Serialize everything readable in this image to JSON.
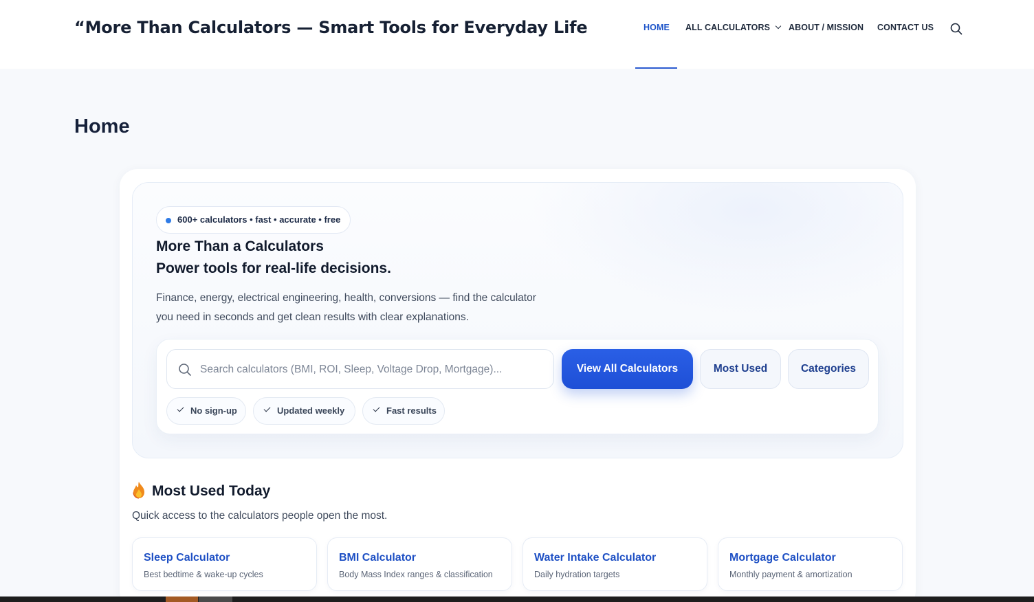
{
  "site": {
    "title": "“More Than Calculators — Smart Tools for Everyday Life"
  },
  "nav": {
    "items": [
      {
        "label": "HOME",
        "active": true
      },
      {
        "label": "ALL CALCULATORS",
        "has_dropdown": true
      },
      {
        "label": "ABOUT / MISSION"
      },
      {
        "label": "CONTACT US"
      }
    ],
    "search_icon": "search-icon"
  },
  "page": {
    "title": "Home"
  },
  "hero": {
    "badge": "600+ calculators • fast • accurate • free",
    "heading_line1": "More Than a Calculators",
    "heading_line2": "Power tools for real-life decisions.",
    "description": "Finance, energy, electrical engineering, health, conversions — find the calculator you need in seconds and get clean results with clear explanations.",
    "search": {
      "placeholder": "Search calculators (BMI, ROI, Sleep, Voltage Drop, Mortgage)...",
      "value": ""
    },
    "buttons": {
      "view_all": "View All Calculators",
      "most_used": "Most Used",
      "categories": "Categories"
    },
    "chips": [
      "No sign-up",
      "Updated weekly",
      "Fast results"
    ]
  },
  "most_used": {
    "title": "Most Used Today",
    "icon": "flame-icon",
    "subtitle": "Quick access to the calculators people open the most.",
    "cards": [
      {
        "name": "Sleep Calculator",
        "desc": "Best bedtime & wake-up cycles"
      },
      {
        "name": "BMI Calculator",
        "desc": "Body Mass Index ranges & classification"
      },
      {
        "name": "Water Intake Calculator",
        "desc": "Daily hydration targets"
      },
      {
        "name": "Mortgage Calculator",
        "desc": "Monthly payment & amortization"
      }
    ]
  },
  "colors": {
    "accent": "#1d54c9",
    "primary_button": "#2458e0",
    "link": "#1d4fc4",
    "background": "#f7f9fc"
  }
}
